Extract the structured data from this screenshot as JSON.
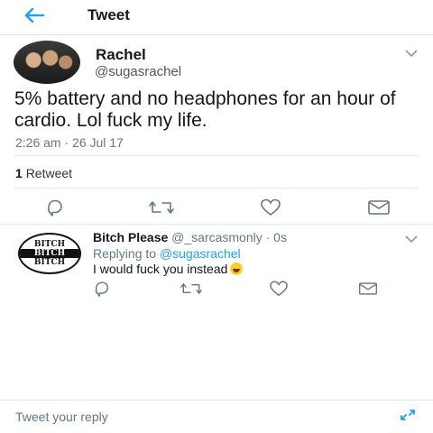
{
  "header": {
    "title": "Tweet",
    "back_icon": "back-arrow-icon"
  },
  "colors": {
    "accent": "#1da1f2",
    "secondary_text": "#657786",
    "divider": "#e1e8ed"
  },
  "tweet": {
    "name": "Rachel",
    "handle": "@sugasrachel",
    "text": "5% battery and no headphones for an hour of cardio. Lol fuck my life.",
    "timestamp": "2:26 am · 26 Jul 17",
    "retweet_count": "1",
    "retweet_label": "Retweet",
    "actions": [
      "reply-icon",
      "retweet-icon",
      "like-icon",
      "message-icon"
    ]
  },
  "reply": {
    "name": "Bitch Please",
    "handle": "@_sarcasmonly",
    "time": "· 0s",
    "replying_prefix": "Replying to",
    "replying_to": "@sugasrachel",
    "text": "I would fuck you instead",
    "avatar_lines": [
      "BITCH",
      "BITCH",
      "BITCH"
    ],
    "actions": [
      "reply-icon",
      "retweet-icon",
      "like-icon",
      "message-icon"
    ]
  },
  "compose": {
    "placeholder": "Tweet your reply",
    "icon": "expand-icon"
  }
}
